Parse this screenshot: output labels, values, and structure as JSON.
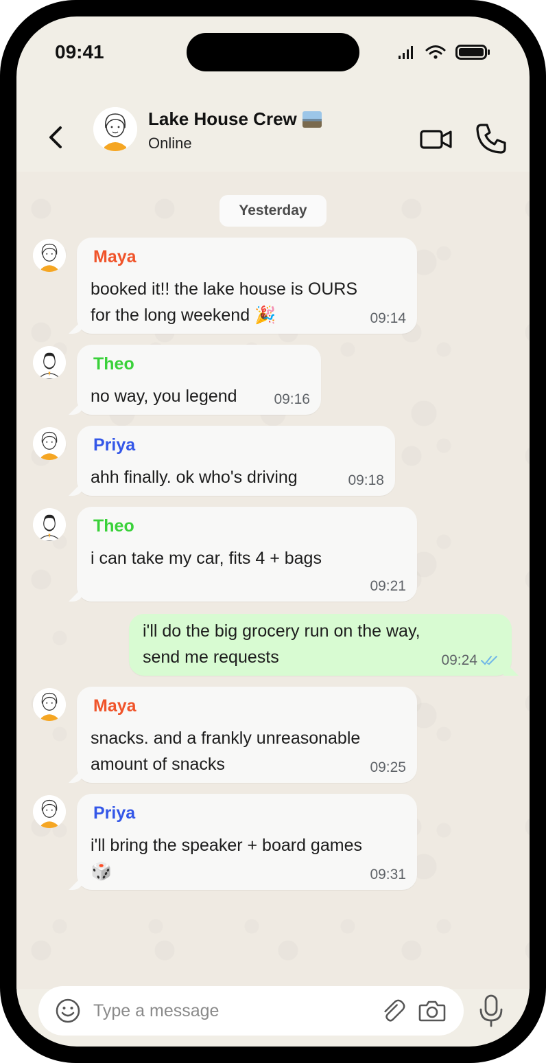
{
  "status_bar": {
    "time": "09:41"
  },
  "chat": {
    "title": "Lake House Crew",
    "title_emoji": "lake-photo-emoji",
    "status": "Online"
  },
  "date_chip": "Yesterday",
  "messages": [
    {
      "sender": "Maya",
      "lines": [
        "booked it!! the lake house is OURS",
        "for the long weekend 🎉"
      ],
      "time": "09:14",
      "sender_color": "#f0542a"
    },
    {
      "sender": "Theo",
      "lines": [
        "no way, you legend"
      ],
      "time": "09:16",
      "sender_color": "#3ad13a"
    },
    {
      "sender": "Priya",
      "lines": [
        "ahh finally. ok who's driving"
      ],
      "time": "09:18",
      "sender_color": "#3457e8"
    },
    {
      "sender": "Theo",
      "lines": [
        "i can take my car, fits 4 + bags"
      ],
      "time": "09:21",
      "sender_color": "#3ad13a"
    },
    {
      "sender": "",
      "lines": [
        "i'll do the big grocery run on the way,",
        "send me requests"
      ],
      "time": "09:24",
      "outgoing": true,
      "read": true
    },
    {
      "sender": "Maya",
      "lines": [
        "snacks. and a frankly unreasonable",
        "amount of snacks"
      ],
      "time": "09:25",
      "sender_color": "#f0542a"
    },
    {
      "sender": "Priya",
      "lines": [
        "i'll bring the speaker + board games",
        "🎲"
      ],
      "time": "09:31",
      "sender_color": "#3457e8"
    }
  ],
  "input": {
    "placeholder": "Type a message"
  },
  "colors": {
    "background": "#efeae2",
    "incoming_bubble": "#f8f8f7",
    "outgoing_bubble": "#d8fbd2",
    "read_ticks": "#6fb6e8"
  }
}
